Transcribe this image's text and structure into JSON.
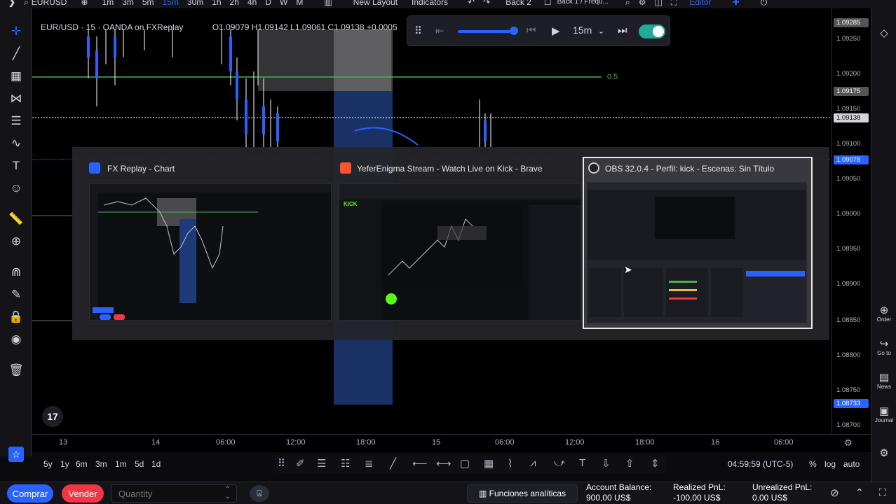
{
  "top_toolbar": {
    "symbol": "EURUSD",
    "intervals": [
      "1m",
      "3m",
      "5m",
      "15m",
      "30m",
      "1h",
      "2h",
      "4h",
      "D",
      "W",
      "M"
    ],
    "active_interval": "15m",
    "layout_label": "New Layout",
    "indicators_label": "Indicators",
    "back_label": "Back 2",
    "session_label": "Back 1 / Frequ...",
    "editor_label": "Editor"
  },
  "legend": {
    "title": "EUR/USD · 15 · OANDA on FXReplay",
    "ohlc": "O1.09079 H1.09142 L1.09061 C1.09138 +0.0005"
  },
  "replay": {
    "interval": "15m"
  },
  "chart_lines": {
    "level_label": "0.5"
  },
  "price_scale": {
    "labels": [
      "1.09285",
      "1.09250",
      "1.09200",
      "1.09175",
      "1.09150",
      "1.09138",
      "1.09100",
      "1.09078",
      "1.09050",
      "1.09000",
      "1.08950",
      "1.08900",
      "1.08850",
      "1.08800",
      "1.08750",
      "1.08733",
      "1.08700"
    ],
    "current_price_tag": "1.09138",
    "blue_tag_1": "1.09078",
    "blue_tag_2": "1.08733",
    "grey_tag": "1.09175",
    "top_tag": "1.09285"
  },
  "time_scale": {
    "labels": [
      "13",
      "14",
      "06:00",
      "12:00",
      "18:00",
      "15",
      "06:00",
      "12:00",
      "18:00",
      "16",
      "06:00"
    ]
  },
  "range_bar": {
    "ranges": [
      "5y",
      "1y",
      "6m",
      "3m",
      "1m",
      "5d",
      "1d"
    ],
    "clock": "04:59:59 (UTC-5)",
    "percent": "%",
    "log": "log",
    "auto": "auto"
  },
  "right_rail": {
    "order": "Order",
    "goto": "Go to",
    "news": "News",
    "journal": "Journal"
  },
  "bottom_bar": {
    "buy_label": "Comprar",
    "sell_label": "Vender",
    "quantity_placeholder": "Quantity",
    "analytics_label": "Funciones analíticas",
    "account_balance_label": "Account Balance:",
    "account_balance_value": "900,00 US$",
    "realized_label": "Realized PnL:",
    "realized_value": "-100,00 US$",
    "unrealized_label": "Unrealized PnL:",
    "unrealized_value": "0,00 US$"
  },
  "switcher": {
    "windows": [
      {
        "title": "FX Replay - Chart",
        "icon": "fxreplay-icon",
        "selected": false
      },
      {
        "title": "YeferEnigma Stream - Watch Live on Kick - Brave",
        "icon": "brave-icon",
        "selected": false
      },
      {
        "title": "OBS 32.0.4 - Perfil: kick - Escenas: Sin Título",
        "icon": "obs-icon",
        "selected": true
      }
    ],
    "kick_logo": "KICK"
  },
  "colors": {
    "bg": "#000000",
    "toolbar": "#131318",
    "accent_blue": "#2962ff",
    "green_level": "#4caf50",
    "buy_blue": "#2962ff",
    "sell_red": "#f23645",
    "replay_toggle": "#22ab94"
  }
}
